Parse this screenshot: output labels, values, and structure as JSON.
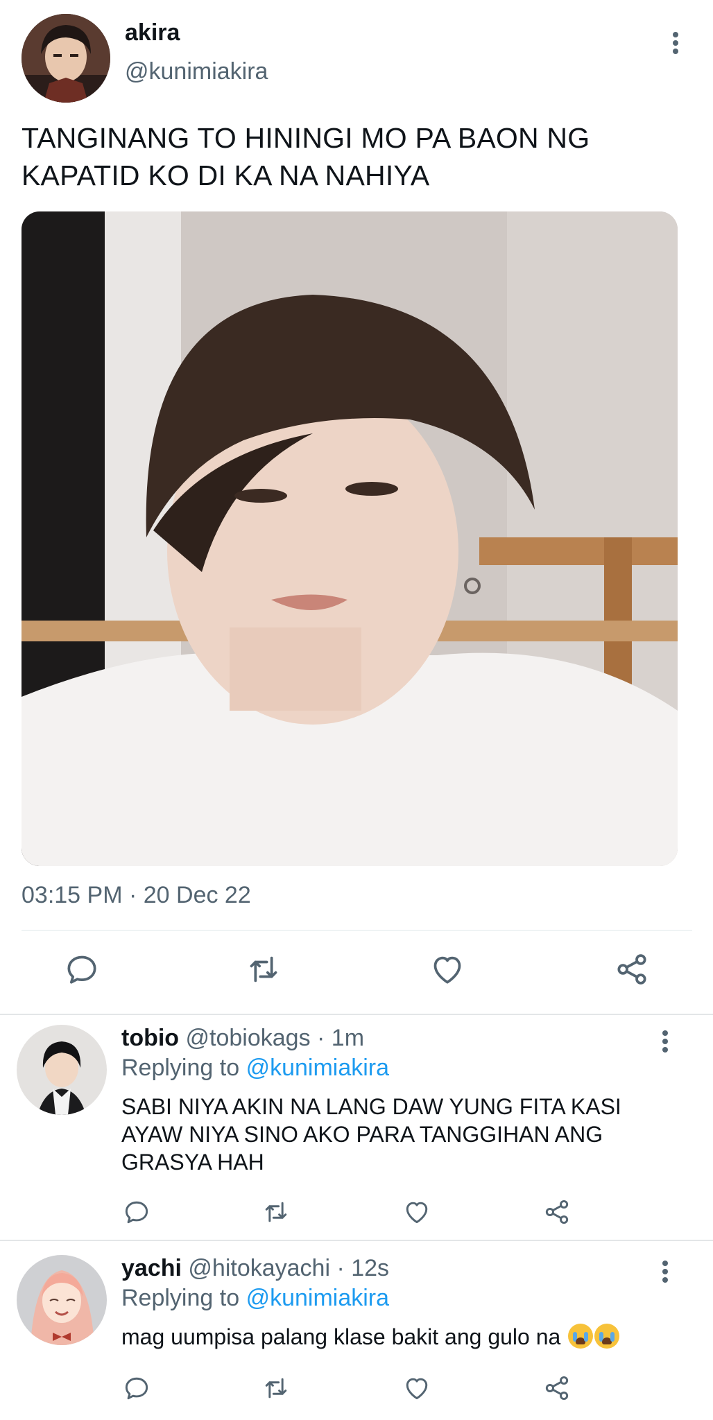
{
  "main_tweet": {
    "author_name": "akira",
    "author_handle": "@kunimiakira",
    "text": "TANGINANG TO HININGI MO PA BAON NG KAPATID KO DI KA NA NAHIYA",
    "timestamp": "03:15 PM · 20 Dec 22",
    "actions": [
      "reply-icon",
      "retweet-icon",
      "like-icon",
      "share-icon"
    ]
  },
  "replies": [
    {
      "name": "tobio",
      "meta": "@tobiokags · 1m",
      "replying_prefix": "Replying to",
      "replying_handle": "@kunimiakira",
      "text": "SABI NIYA AKIN NA LANG DAW YUNG FITA KASI AYAW NIYA SINO AKO PARA TANGGIHAN ANG GRASYA HAH"
    },
    {
      "name": "yachi",
      "meta": "@hitokayachi · 12s",
      "replying_prefix": "Replying to",
      "replying_handle": "@kunimiakira",
      "text": "mag uumpisa palang klase bakit ang gulo na",
      "emoji": "loudly-crying-face-emoji"
    }
  ],
  "colors": {
    "text_primary": "#0f1419",
    "text_secondary": "#536471",
    "link": "#1d9bf0",
    "divider": "#eff3f4"
  }
}
